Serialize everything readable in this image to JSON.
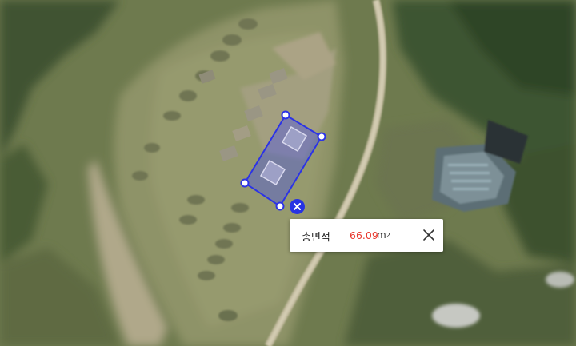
{
  "map": {
    "layer": "satellite"
  },
  "measurement": {
    "shape": "polygon",
    "stroke_color": "#2c33e6",
    "fill_color": "#3a46ff",
    "vertex_fill": "#ffffff"
  },
  "popup": {
    "label": "총면적",
    "value": "66.09",
    "unit": "m",
    "unit_exponent": "2",
    "value_color": "#e83a2f"
  },
  "icons": {
    "popup_close": "close-icon",
    "delete_measurement": "delete-x-icon"
  }
}
